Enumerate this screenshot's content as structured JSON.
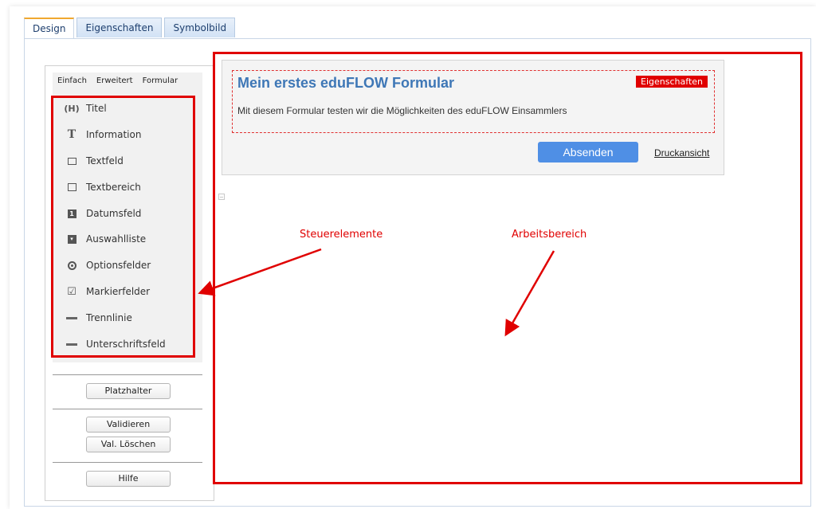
{
  "tabs": [
    {
      "label": "Design",
      "active": true
    },
    {
      "label": "Eigenschaften",
      "active": false
    },
    {
      "label": "Symbolbild",
      "active": false
    }
  ],
  "sidebar": {
    "subtabs": [
      {
        "label": "Einfach",
        "active": true
      },
      {
        "label": "Erweitert",
        "active": false
      },
      {
        "label": "Formular",
        "active": false
      }
    ],
    "items": [
      {
        "label": "Titel",
        "icon": "title-icon"
      },
      {
        "label": "Information",
        "icon": "text-t-icon"
      },
      {
        "label": "Textfeld",
        "icon": "textfield-icon"
      },
      {
        "label": "Textbereich",
        "icon": "textarea-icon"
      },
      {
        "label": "Datumsfeld",
        "icon": "calendar-icon"
      },
      {
        "label": "Auswahlliste",
        "icon": "dropdown-icon"
      },
      {
        "label": "Optionsfelder",
        "icon": "radio-icon"
      },
      {
        "label": "Markierfelder",
        "icon": "checkbox-icon"
      },
      {
        "label": "Trennlinie",
        "icon": "divider-line-icon"
      },
      {
        "label": "Unterschriftsfeld",
        "icon": "signature-line-icon"
      }
    ],
    "buttons": {
      "placeholder": "Platzhalter",
      "validate": "Validieren",
      "clear_validation": "Val. Löschen",
      "help": "Hilfe"
    }
  },
  "form": {
    "title": "Mein erstes eduFLOW Formular",
    "properties_badge": "Eigenschaften",
    "description": "Mit diesem Formular testen wir die Möglichkeiten des eduFLOW Einsammlers",
    "submit_label": "Absenden",
    "print_view_label": "Druckansicht"
  },
  "annotations": {
    "controls_label": "Steuerelemente",
    "workspace_label": "Arbeitsbereich",
    "color": "#e00000"
  }
}
